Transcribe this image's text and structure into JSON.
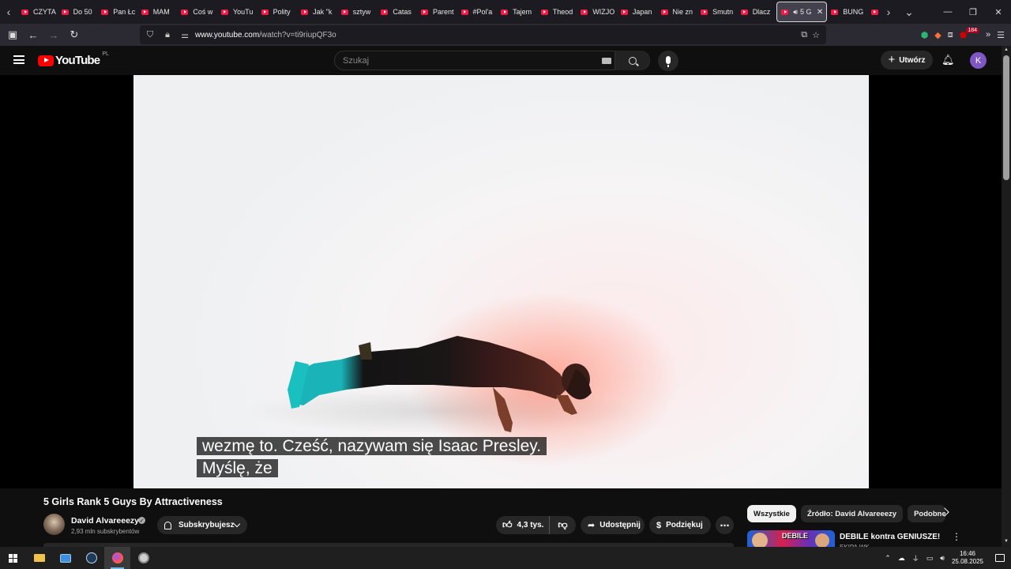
{
  "browser": {
    "tabs": [
      {
        "label": "CZYTA"
      },
      {
        "label": "Do 50"
      },
      {
        "label": "Pan Łc"
      },
      {
        "label": "MAM"
      },
      {
        "label": "Coś w"
      },
      {
        "label": "YouTu"
      },
      {
        "label": "Polity"
      },
      {
        "label": "Jak \"k"
      },
      {
        "label": "sztyw"
      },
      {
        "label": "Catas"
      },
      {
        "label": "Parent"
      },
      {
        "label": "#Pol'a"
      },
      {
        "label": "Tajem"
      },
      {
        "label": "Theod"
      },
      {
        "label": "WIZJO"
      },
      {
        "label": "Japan"
      },
      {
        "label": "Nie zn"
      },
      {
        "label": "Smutn"
      },
      {
        "label": "Dlacz"
      },
      {
        "label": "5 G",
        "active": true
      },
      {
        "label": "BUNG"
      },
      {
        "label": "Bun"
      }
    ],
    "url_domain": "www.youtube.com",
    "url_path": "/watch?v=ti9riupQF3o",
    "extension_badge": "184"
  },
  "youtube": {
    "logo_text": "YouTube",
    "country_code": "PL",
    "search_placeholder": "Szukaj",
    "create_label": "Utwórz",
    "avatar_letter": "K",
    "accent_color": "#ff0000"
  },
  "player": {
    "caption_line1": "wezmę to.  Cześć, nazywam się Isaac Presley.",
    "caption_line2": "Myślę, że"
  },
  "video": {
    "title": "5 Girls Rank 5 Guys By Attractiveness",
    "channel_name": "David Alvareeezy",
    "subscribers": "2,93 mln subskrybentów",
    "subscribe_label": "Subskrybujesz",
    "likes": "4,3 tys.",
    "share_label": "Udostępnij",
    "thanks_label": "Podziękuj"
  },
  "sidebar": {
    "chips": [
      {
        "label": "Wszystkie",
        "active": true
      },
      {
        "label": "Źródło: David Alvareeezy"
      },
      {
        "label": "Podobne"
      }
    ],
    "rec_title": "DEBILE kontra GENIUSZE!",
    "rec_channel": "EKIPA WK",
    "rec_thumb_text": "DEBILE"
  },
  "taskbar": {
    "time": "16:46",
    "date": "25.08.2025"
  }
}
